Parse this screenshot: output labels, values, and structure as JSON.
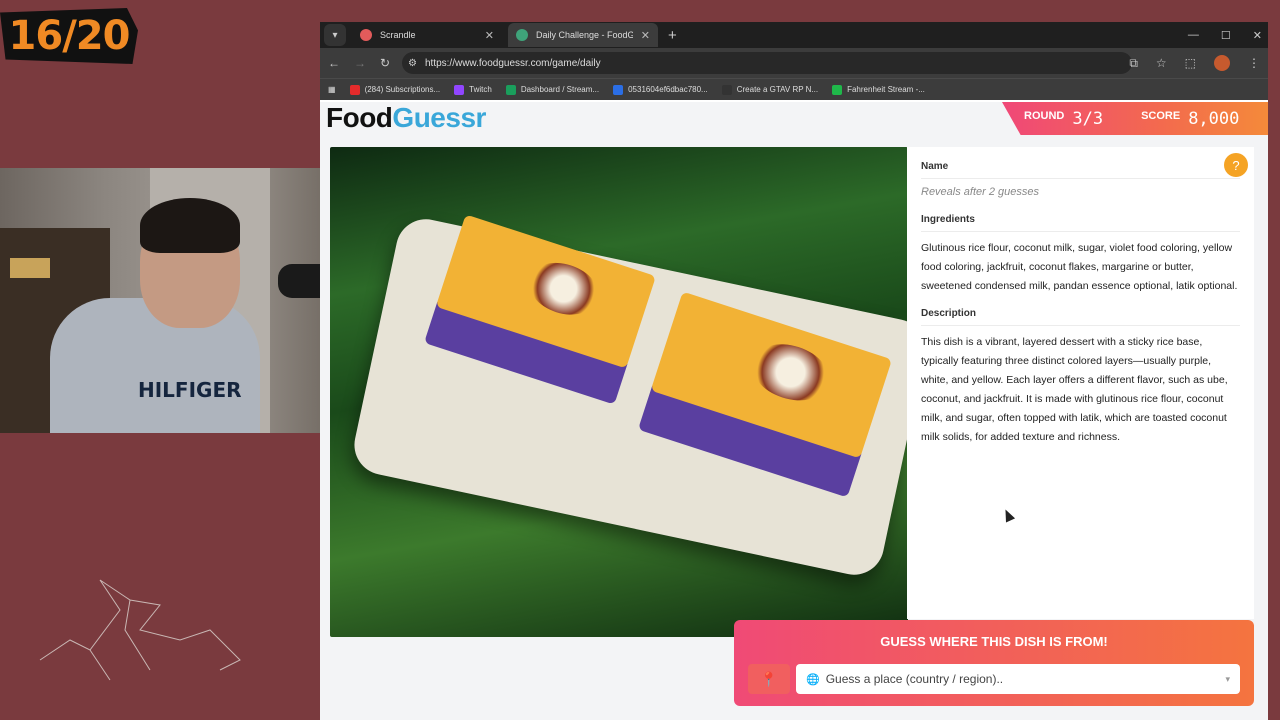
{
  "overlay": {
    "counter": "16/20",
    "shirt_text": "HILFIGER"
  },
  "browser": {
    "tabs": [
      {
        "title": "Scrandle",
        "active": false,
        "favicon_color": "#e25b5b"
      },
      {
        "title": "Daily Challenge - FoodGuessr |",
        "active": true,
        "favicon_color": "#3fa37a"
      }
    ],
    "url": "https://www.foodguessr.com/game/daily",
    "bookmarks": [
      {
        "label": "(284) Subscriptions...",
        "color": "#e52b2b"
      },
      {
        "label": "Twitch",
        "color": "#9146ff"
      },
      {
        "label": "Dashboard / Stream...",
        "color": "#1a9e5c"
      },
      {
        "label": "0531604ef6dbac780...",
        "color": "#2b6ee5"
      },
      {
        "label": "Create a GTAV RP N...",
        "color": "#333333"
      },
      {
        "label": "Fahrenheit Stream -...",
        "color": "#1fb84a"
      }
    ]
  },
  "game": {
    "logo_food": "Food",
    "logo_guessr": "Guessr",
    "round_label": "ROUND",
    "round_value": "3/3",
    "score_label": "SCORE",
    "score_value": "8,000",
    "help_icon": "?",
    "name_title": "Name",
    "name_reveal": "Reveals after 2 guesses",
    "ingredients_title": "Ingredients",
    "ingredients_text": "Glutinous rice flour, coconut milk, sugar, violet food coloring, yellow food coloring, jackfruit, coconut flakes, margarine or butter, sweetened condensed milk, pandan essence optional, latik optional.",
    "description_title": "Description",
    "description_text": "This dish is a vibrant, layered dessert with a sticky rice base, typically featuring three distinct colored layers—usually purple, white, and yellow. Each layer offers a different flavor, such as ube, coconut, and jackfruit. It is made with glutinous rice flour, coconut milk, and sugar, often topped with latik, which are toasted coconut milk solids, for added texture and richness.",
    "guess_heading": "GUESS WHERE THIS DISH IS FROM!",
    "guess_placeholder": "Guess a place (country / region).."
  },
  "colors": {
    "accent_pink": "#f04a76",
    "accent_orange": "#f4743f",
    "logo_blue": "#3aa7d9"
  }
}
